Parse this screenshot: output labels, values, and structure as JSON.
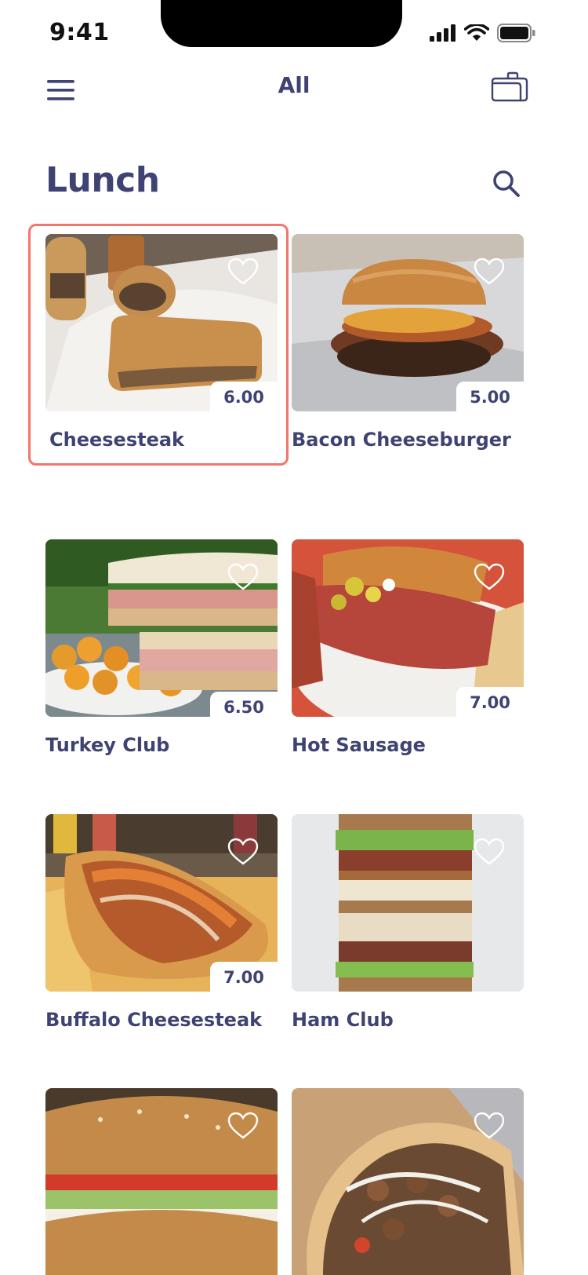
{
  "status_bar": {
    "time": "9:41"
  },
  "nav": {
    "title": "All",
    "menu_icon": "hamburger-icon",
    "basket_icon": "basket-icon"
  },
  "section": {
    "title": "Lunch",
    "search_icon": "search-icon"
  },
  "colors": {
    "text": "#3f4373",
    "accent": "#f2766a",
    "background": "#ffffff"
  },
  "items": [
    {
      "name": "Cheesesteak",
      "price": "6.00",
      "selected": true
    },
    {
      "name": "Bacon Cheeseburger",
      "price": "5.00"
    },
    {
      "name": "Turkey Club",
      "price": "6.50"
    },
    {
      "name": "Hot Sausage",
      "price": "7.00"
    },
    {
      "name": "Buffalo Cheesesteak",
      "price": "7.00"
    },
    {
      "name": "Ham Club",
      "price": ""
    },
    {
      "name": "",
      "price": ""
    },
    {
      "name": "",
      "price": ""
    }
  ]
}
